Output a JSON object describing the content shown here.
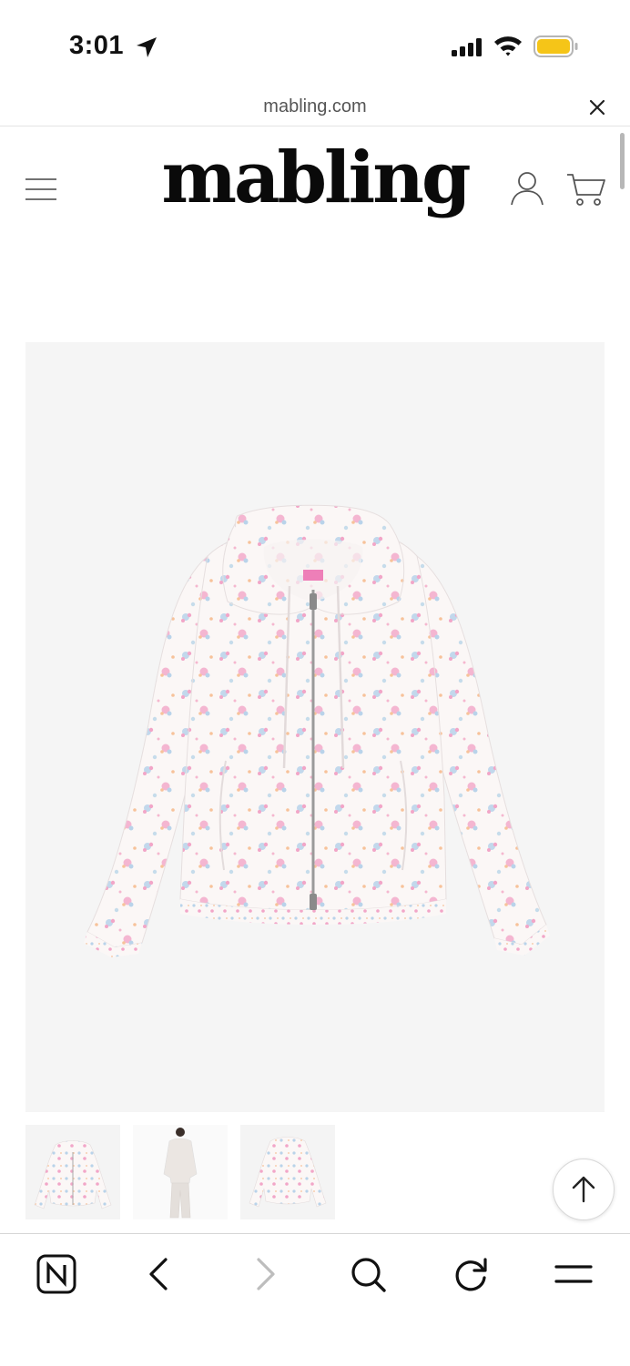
{
  "status_bar": {
    "time": "3:01",
    "icons": [
      "location-arrow-icon",
      "cellular-signal-icon",
      "wifi-icon",
      "battery-icon"
    ],
    "battery_color": "#F5C518"
  },
  "browser": {
    "url": "mabling.com",
    "close_icon": "close-icon"
  },
  "site_header": {
    "logo": "mabling",
    "menu_icon": "hamburger-menu-icon",
    "account_icon": "user-icon",
    "cart_icon": "cart-icon"
  },
  "product": {
    "main_image": "floral-print-zip-up-hoodie",
    "thumbnails": [
      "hoodie-front-flat",
      "model-wearing-set",
      "hoodie-back-flat"
    ]
  },
  "scroll_top_icon": "arrow-up-icon",
  "toolbar": {
    "buttons": [
      "naver-home-icon",
      "back-icon",
      "forward-icon",
      "search-icon",
      "refresh-icon",
      "menu-icon"
    ]
  },
  "colors": {
    "image_background": "#F5F5F5",
    "print_pink": "#F2A6C8",
    "print_blue": "#B9D3EA",
    "print_peach": "#F7C29A"
  }
}
